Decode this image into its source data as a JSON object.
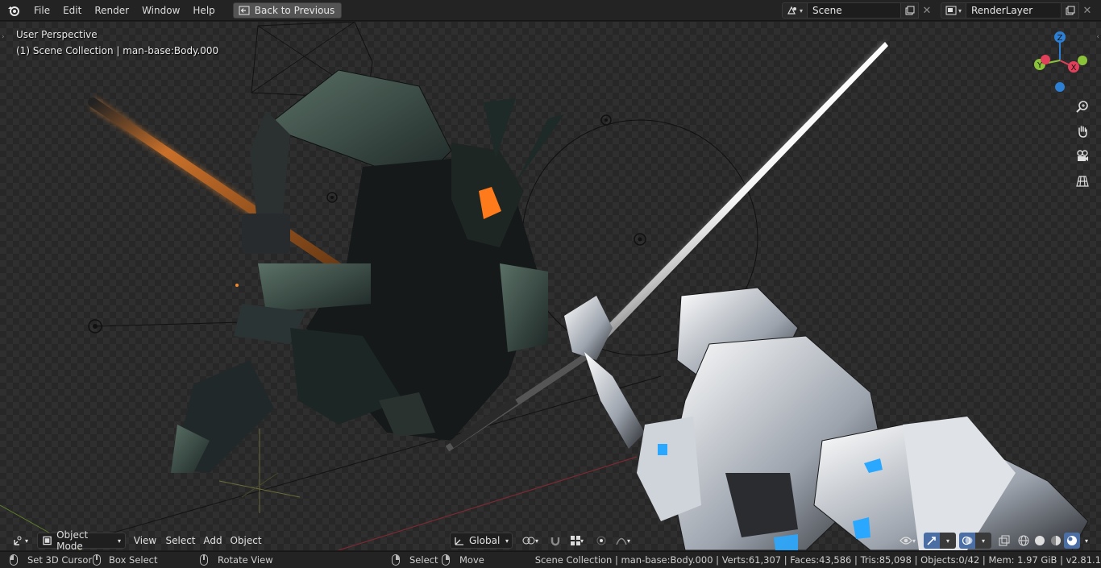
{
  "topbar": {
    "menus": [
      "File",
      "Edit",
      "Render",
      "Window",
      "Help"
    ],
    "back_button": "Back to Previous",
    "scene_name": "Scene",
    "render_layer": "RenderLayer"
  },
  "viewport": {
    "perspective_label": "User Perspective",
    "collection_label": "(1) Scene Collection | man-base:Body.000",
    "gizmo_axes": {
      "z": "Z",
      "x": "X",
      "y": "Y"
    },
    "colors": {
      "x_axis": "#e0405a",
      "y_axis": "#8ac33a",
      "z_axis": "#2d7fd4",
      "floor_red": "#7a2a33",
      "floor_green": "#5c7a2a"
    }
  },
  "header": {
    "mode": "Object Mode",
    "menus": [
      "View",
      "Select",
      "Add",
      "Object"
    ],
    "transform_orientation": "Global"
  },
  "statusbar": {
    "set_cursor": "Set 3D Cursor",
    "box_select": "Box Select",
    "rotate_view": "Rotate View",
    "select": "Select",
    "move": "Move",
    "stats": "Scene Collection | man-base:Body.000 | Verts:61,307 | Faces:43,586 | Tris:85,098 | Objects:0/42 | Mem: 1.97 GiB | v2.81.1"
  }
}
